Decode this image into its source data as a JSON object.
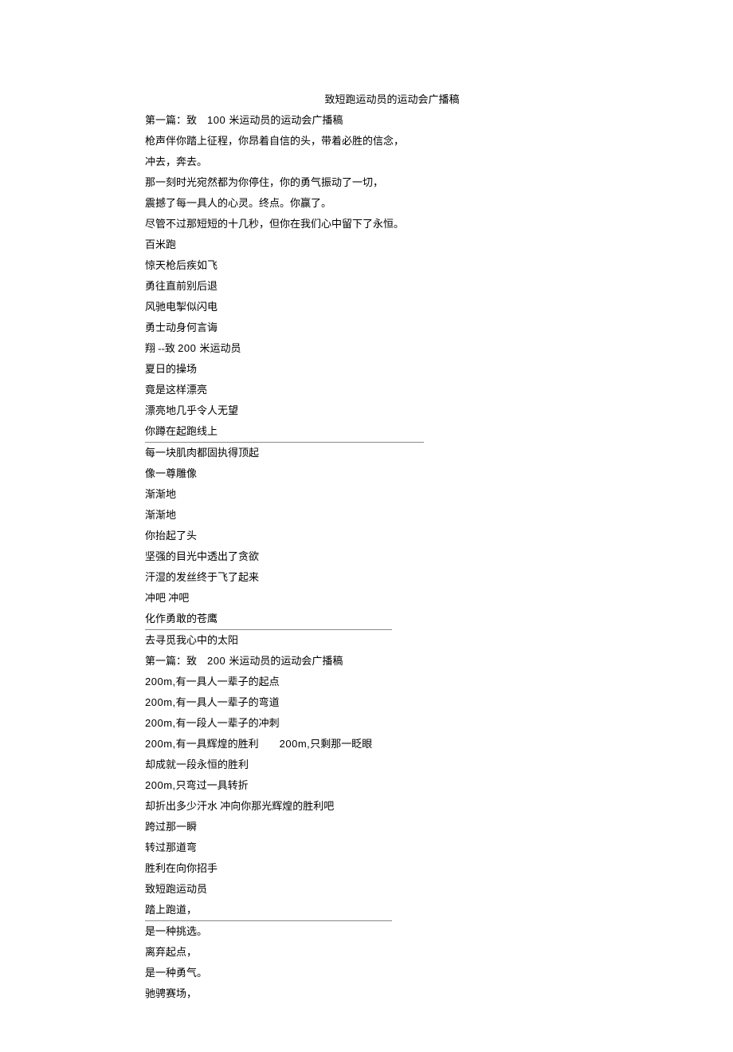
{
  "title": "致短跑运动员的运动会广播稿",
  "lines": [
    {
      "segments": [
        {
          "text": "第一篇：致　"
        },
        {
          "text": "100 ",
          "class": "num"
        },
        {
          "text": "米运动员的运动会广播稿"
        }
      ]
    },
    {
      "text": "枪声伴你踏上征程，你昂着自信的头，带着必胜的信念，"
    },
    {
      "text": "冲去，奔去。"
    },
    {
      "text": "那一刻时光宛然都为你停住，你的勇气振动了一切，"
    },
    {
      "text": "震撼了每一具人的心灵。终点。你赢了。"
    },
    {
      "text": "尽管不过那短短的十几秒，但你在我们心中留下了永恒。"
    },
    {
      "text": "百米跑"
    },
    {
      "text": "惊天枪后疾如飞"
    },
    {
      "text": "勇往直前别后退"
    },
    {
      "text": "风驰电掣似闪电"
    },
    {
      "text": "勇士动身何言诲"
    },
    {
      "segments": [
        {
          "text": "翔 --致 "
        },
        {
          "text": "200 ",
          "class": "num"
        },
        {
          "text": "米运动员"
        }
      ]
    },
    {
      "text": "夏日的操场"
    },
    {
      "text": "竟是这样漂亮"
    },
    {
      "text": "漂亮地几乎令人无望"
    },
    {
      "text": "你蹲在起跑线上",
      "underline": "long"
    },
    {
      "text": "每一块肌肉都固执得顶起"
    },
    {
      "text": "像一尊雕像"
    },
    {
      "text": "渐渐地"
    },
    {
      "text": "渐渐地"
    },
    {
      "text": "你抬起了头"
    },
    {
      "text": "坚强的目光中透出了贪欲"
    },
    {
      "text": "汗湿的发丝终于飞了起来"
    },
    {
      "text": "冲吧 冲吧"
    },
    {
      "text": "化作勇敢的苍鹰",
      "underline": "short"
    },
    {
      "text": "去寻觅我心中的太阳"
    },
    {
      "segments": [
        {
          "text": "第一篇：致　"
        },
        {
          "text": "200 ",
          "class": "num"
        },
        {
          "text": "米运动员的运动会广播稿"
        }
      ]
    },
    {
      "segments": [
        {
          "text": "200m,",
          "class": "num"
        },
        {
          "text": "有一具人一辈子的起点"
        }
      ]
    },
    {
      "segments": [
        {
          "text": "200m,",
          "class": "num"
        },
        {
          "text": "有一具人一辈子的弯道"
        }
      ]
    },
    {
      "segments": [
        {
          "text": "200m,",
          "class": "num"
        },
        {
          "text": "有一段人一辈子的冲刺"
        }
      ]
    },
    {
      "segments": [
        {
          "text": "200m,",
          "class": "num"
        },
        {
          "text": "有一具辉煌的胜利　　"
        },
        {
          "text": "200m,",
          "class": "num"
        },
        {
          "text": "只剩那一眨眼"
        }
      ]
    },
    {
      "text": "却成就一段永恒的胜利"
    },
    {
      "segments": [
        {
          "text": "200m,",
          "class": "num"
        },
        {
          "text": "只弯过一具转折"
        }
      ]
    },
    {
      "text": "却折出多少汗水 冲向你那光辉煌的胜利吧"
    },
    {
      "text": "跨过那一瞬"
    },
    {
      "text": "转过那道弯"
    },
    {
      "text": "胜利在向你招手"
    },
    {
      "text": "致短跑运动员"
    },
    {
      "text": "踏上跑道，",
      "underline": "short"
    },
    {
      "text": "是一种挑选。"
    },
    {
      "text": "离弃起点，"
    },
    {
      "text": "是一种勇气。"
    },
    {
      "text": "驰骋赛场，"
    }
  ]
}
